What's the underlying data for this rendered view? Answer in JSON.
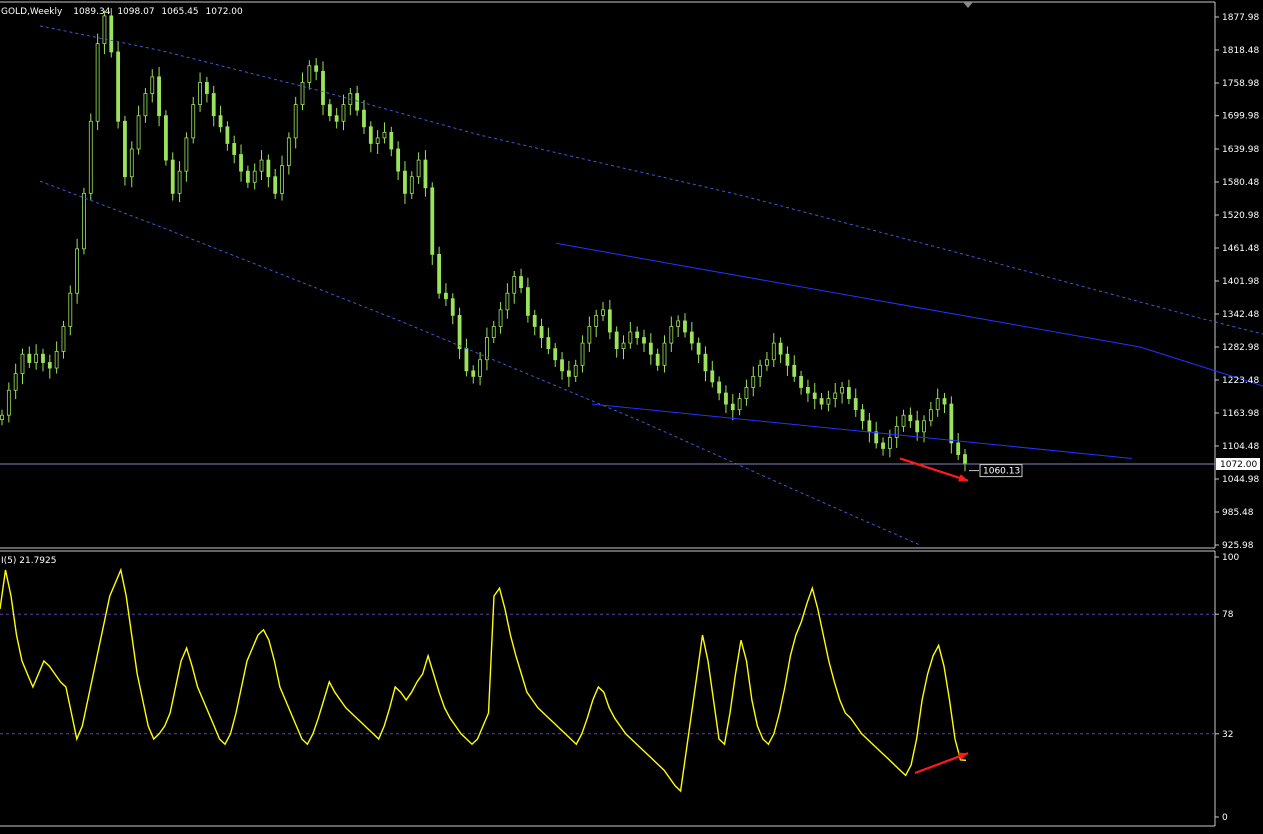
{
  "chart_data": [
    {
      "type": "candlestick",
      "header": {
        "symbol": "GOLD,Weekly",
        "ohlc": [
          "1089.34",
          "1098.07",
          "1065.45",
          "1072.00"
        ]
      },
      "y_ticks": [
        "1877.98",
        "1818.48",
        "1758.98",
        "1699.98",
        "1639.98",
        "1580.48",
        "1520.98",
        "1461.48",
        "1401.98",
        "1342.48",
        "1282.98",
        "1223.48",
        "1163.98",
        "1104.48",
        "1044.98",
        "985.48",
        "925.98"
      ],
      "ylim": [
        925.98,
        1877.98
      ],
      "last_price_label": "1072.00",
      "last_price": 1072.0,
      "target_label": "1060.13",
      "target_price": 1060.13,
      "close_series": [
        1160,
        1205,
        1235,
        1270,
        1255,
        1270,
        1255,
        1245,
        1275,
        1320,
        1380,
        1460,
        1560,
        1690,
        1830,
        1880,
        1815,
        1690,
        1590,
        1640,
        1700,
        1740,
        1770,
        1700,
        1620,
        1560,
        1600,
        1660,
        1720,
        1760,
        1740,
        1700,
        1680,
        1650,
        1630,
        1600,
        1580,
        1600,
        1620,
        1590,
        1560,
        1610,
        1660,
        1720,
        1760,
        1790,
        1780,
        1720,
        1700,
        1690,
        1720,
        1740,
        1710,
        1680,
        1650,
        1660,
        1670,
        1640,
        1600,
        1560,
        1590,
        1620,
        1570,
        1450,
        1380,
        1370,
        1340,
        1280,
        1240,
        1230,
        1260,
        1300,
        1320,
        1350,
        1380,
        1410,
        1390,
        1340,
        1320,
        1300,
        1280,
        1260,
        1240,
        1230,
        1250,
        1290,
        1320,
        1340,
        1350,
        1310,
        1280,
        1290,
        1310,
        1300,
        1290,
        1270,
        1250,
        1290,
        1320,
        1330,
        1310,
        1290,
        1270,
        1240,
        1220,
        1200,
        1180,
        1170,
        1190,
        1210,
        1230,
        1250,
        1260,
        1290,
        1270,
        1250,
        1230,
        1210,
        1200,
        1190,
        1180,
        1190,
        1200,
        1210,
        1190,
        1170,
        1150,
        1130,
        1110,
        1100,
        1120,
        1140,
        1160,
        1150,
        1130,
        1150,
        1170,
        1190,
        1180,
        1110,
        1089,
        1072
      ],
      "channel_upper": [
        [
          1.0,
          1862
        ],
        [
          4.0,
          1818
        ],
        [
          8.0,
          1745
        ],
        [
          12.0,
          1665
        ],
        [
          18.5,
          1557
        ],
        [
          24.0,
          1452
        ],
        [
          30.0,
          1335
        ],
        [
          36.0,
          1225
        ]
      ],
      "channel_lower": [
        [
          1.0,
          1582
        ],
        [
          4.0,
          1500
        ],
        [
          10.0,
          1330
        ],
        [
          16.0,
          1150
        ],
        [
          20.5,
          1005
        ],
        [
          23.0,
          925.98
        ]
      ],
      "wedge_upper": [
        [
          13.9,
          1470
        ],
        [
          28.5,
          1283
        ],
        [
          33.0,
          1180
        ]
      ],
      "wedge_lower": [
        [
          14.8,
          1180
        ],
        [
          28.3,
          1082
        ]
      ],
      "price_arrow": [
        [
          28.4,
          1082
        ],
        [
          30.6,
          1060
        ]
      ]
    },
    {
      "type": "line",
      "header": "I(5) 21.7925",
      "y_ticks": [
        "100",
        "78",
        "32",
        "0"
      ],
      "ylim": [
        0,
        100
      ],
      "levels": [
        78,
        32
      ],
      "values": [
        80,
        95,
        85,
        70,
        60,
        55,
        50,
        55,
        60,
        58,
        55,
        52,
        50,
        40,
        30,
        35,
        45,
        55,
        65,
        75,
        85,
        90,
        95,
        85,
        70,
        55,
        45,
        35,
        30,
        32,
        35,
        40,
        50,
        60,
        65,
        58,
        50,
        45,
        40,
        35,
        30,
        28,
        32,
        40,
        50,
        60,
        65,
        70,
        72,
        68,
        60,
        50,
        45,
        40,
        35,
        30,
        28,
        32,
        38,
        45,
        52,
        48,
        45,
        42,
        40,
        38,
        36,
        34,
        32,
        30,
        35,
        42,
        50,
        48,
        45,
        48,
        52,
        55,
        62,
        55,
        48,
        42,
        38,
        35,
        32,
        30,
        28,
        30,
        35,
        40,
        85,
        88,
        80,
        70,
        62,
        55,
        48,
        45,
        42,
        40,
        38,
        36,
        34,
        32,
        30,
        28,
        32,
        38,
        45,
        50,
        48,
        42,
        38,
        35,
        32,
        30,
        28,
        26,
        24,
        22,
        20,
        18,
        15,
        12,
        10,
        25,
        40,
        55,
        70,
        60,
        45,
        30,
        28,
        40,
        55,
        68,
        60,
        45,
        35,
        30,
        28,
        32,
        40,
        50,
        62,
        70,
        75,
        82,
        88,
        80,
        70,
        60,
        52,
        45,
        40,
        38,
        35,
        32,
        30,
        28,
        26,
        24,
        22,
        20,
        18,
        16,
        20,
        30,
        45,
        55,
        62,
        66,
        58,
        45,
        30,
        22,
        21.79
      ],
      "arrow": [
        [
          28.4,
          15
        ],
        [
          30.6,
          23
        ]
      ]
    }
  ]
}
